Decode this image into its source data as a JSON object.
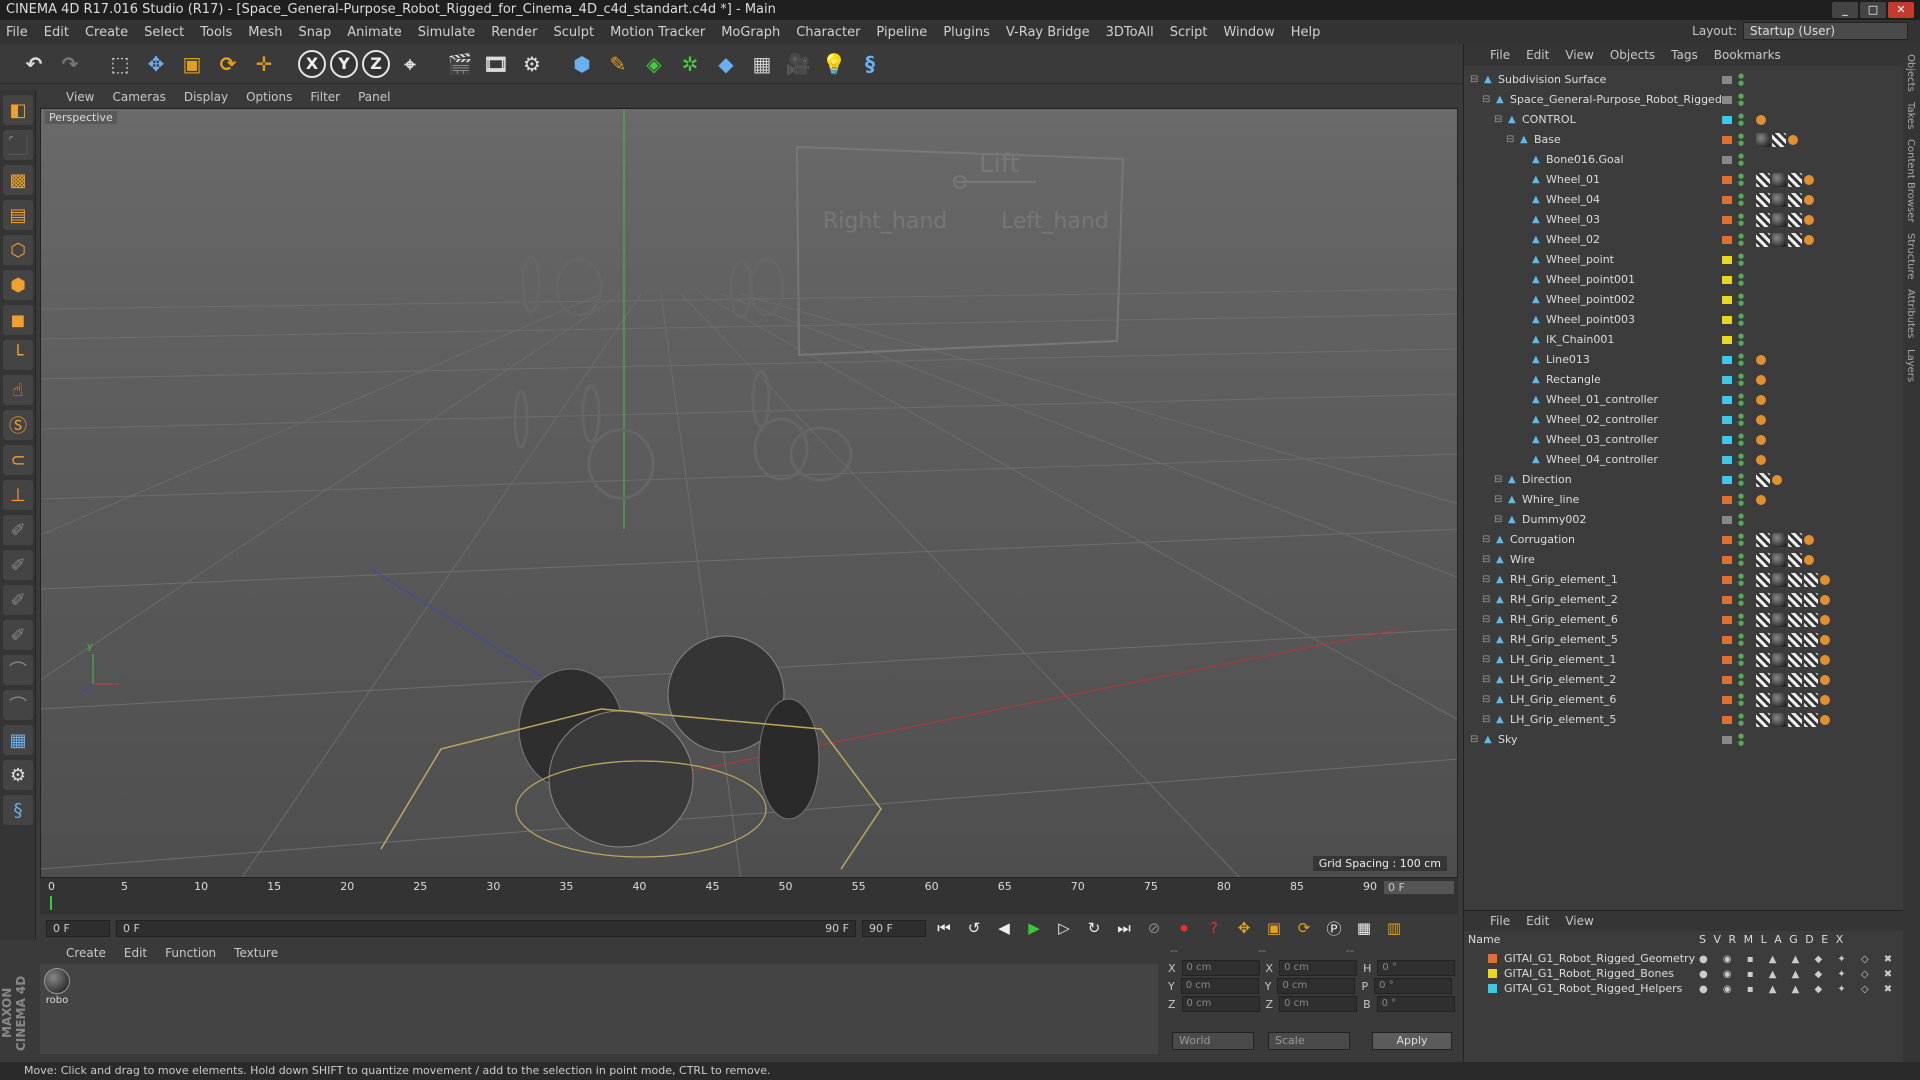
{
  "window": {
    "title": "CINEMA 4D R17.016 Studio (R17) - [Space_General-Purpose_Robot_Rigged_for_Cinema_4D_c4d_standart.c4d *] - Main"
  },
  "menu": [
    "File",
    "Edit",
    "Create",
    "Select",
    "Tools",
    "Mesh",
    "Snap",
    "Animate",
    "Simulate",
    "Render",
    "Sculpt",
    "Motion Tracker",
    "MoGraph",
    "Character",
    "Pipeline",
    "Plugins",
    "V-Ray Bridge",
    "3DToAll",
    "Script",
    "Window",
    "Help"
  ],
  "layout": {
    "label": "Layout:",
    "value": "Startup (User)"
  },
  "toolbar": {
    "axis_x": "X",
    "axis_y": "Y",
    "axis_z": "Z"
  },
  "viewport": {
    "menu": [
      "View",
      "Cameras",
      "Display",
      "Options",
      "Filter",
      "Panel"
    ],
    "label": "Perspective",
    "grid_spacing": "Grid Spacing : 100 cm",
    "board_lift": "Lift",
    "board_right": "Right_hand",
    "board_left": "Left_hand"
  },
  "timeline": {
    "ticks": [
      "0",
      "5",
      "10",
      "15",
      "20",
      "25",
      "30",
      "35",
      "40",
      "45",
      "50",
      "55",
      "60",
      "65",
      "70",
      "75",
      "80",
      "85",
      "90"
    ],
    "current_frame": "0 F"
  },
  "playbar": {
    "start": "0 F",
    "range_start": "0 F",
    "range_end": "90 F",
    "end": "90 F"
  },
  "material": {
    "menu": [
      "Create",
      "Edit",
      "Function",
      "Texture"
    ],
    "name": "robo"
  },
  "coords": {
    "header": [
      "--",
      "--",
      "--"
    ],
    "rows": [
      {
        "a": "X",
        "av": "0 cm",
        "b": "X",
        "bv": "0 cm",
        "c": "H",
        "cv": "0 °"
      },
      {
        "a": "Y",
        "av": "0 cm",
        "b": "Y",
        "bv": "0 cm",
        "c": "P",
        "cv": "0 °"
      },
      {
        "a": "Z",
        "av": "0 cm",
        "b": "Z",
        "bv": "0 cm",
        "c": "B",
        "cv": "0 °"
      }
    ],
    "mode": "World",
    "scale": "Scale",
    "apply": "Apply"
  },
  "brand": "MAXON CINEMA 4D",
  "status": "Move: Click and drag to move elements. Hold down SHIFT to quantize movement / add to the selection in point mode, CTRL to remove.",
  "objects": {
    "menu": [
      "File",
      "Edit",
      "View",
      "Objects",
      "Tags",
      "Bookmarks"
    ],
    "items": [
      {
        "name": "Subdivision Surface",
        "depth": 0,
        "color": "#888888",
        "tags": []
      },
      {
        "name": "Space_General-Purpose_Robot_Rigged",
        "depth": 1,
        "color": "#888888",
        "tags": []
      },
      {
        "name": "CONTROL",
        "depth": 2,
        "color": "#3ec8e8",
        "tags": [
          "o"
        ]
      },
      {
        "name": "Base",
        "depth": 3,
        "color": "#e07030",
        "tags": [
          "k",
          "c",
          "o"
        ]
      },
      {
        "name": "Bone016.Goal",
        "depth": 4,
        "color": "#888888",
        "tags": []
      },
      {
        "name": "Wheel_01",
        "depth": 4,
        "color": "#e07030",
        "tags": [
          "c",
          "k",
          "c",
          "o"
        ]
      },
      {
        "name": "Wheel_04",
        "depth": 4,
        "color": "#e07030",
        "tags": [
          "c",
          "k",
          "c",
          "o"
        ]
      },
      {
        "name": "Wheel_03",
        "depth": 4,
        "color": "#e07030",
        "tags": [
          "c",
          "k",
          "c",
          "o"
        ]
      },
      {
        "name": "Wheel_02",
        "depth": 4,
        "color": "#e07030",
        "tags": [
          "c",
          "k",
          "c",
          "o"
        ]
      },
      {
        "name": "Wheel_point",
        "depth": 4,
        "color": "#e8d820",
        "tags": []
      },
      {
        "name": "Wheel_point001",
        "depth": 4,
        "color": "#e8d820",
        "tags": []
      },
      {
        "name": "Wheel_point002",
        "depth": 4,
        "color": "#e8d820",
        "tags": []
      },
      {
        "name": "Wheel_point003",
        "depth": 4,
        "color": "#e8d820",
        "tags": []
      },
      {
        "name": "IK_Chain001",
        "depth": 4,
        "color": "#e8d820",
        "tags": []
      },
      {
        "name": "Line013",
        "depth": 4,
        "color": "#3ec8e8",
        "tags": [
          "o"
        ]
      },
      {
        "name": "Rectangle",
        "depth": 4,
        "color": "#3ec8e8",
        "tags": [
          "o"
        ]
      },
      {
        "name": "Wheel_01_controller",
        "depth": 4,
        "color": "#3ec8e8",
        "tags": [
          "o"
        ]
      },
      {
        "name": "Wheel_02_controller",
        "depth": 4,
        "color": "#3ec8e8",
        "tags": [
          "o"
        ]
      },
      {
        "name": "Wheel_03_controller",
        "depth": 4,
        "color": "#3ec8e8",
        "tags": [
          "o"
        ]
      },
      {
        "name": "Wheel_04_controller",
        "depth": 4,
        "color": "#3ec8e8",
        "tags": [
          "o"
        ]
      },
      {
        "name": "Direction",
        "depth": 2,
        "color": "#3ec8e8",
        "tags": [
          "c",
          "o"
        ]
      },
      {
        "name": "Whire_line",
        "depth": 2,
        "color": "#e07030",
        "tags": [
          "o"
        ]
      },
      {
        "name": "Dummy002",
        "depth": 2,
        "color": "#888888",
        "tags": []
      },
      {
        "name": "Corrugation",
        "depth": 1,
        "color": "#e07030",
        "tags": [
          "c",
          "k",
          "c",
          "o"
        ]
      },
      {
        "name": "Wire",
        "depth": 1,
        "color": "#e07030",
        "tags": [
          "c",
          "k",
          "c",
          "o"
        ]
      },
      {
        "name": "RH_Grip_element_1",
        "depth": 1,
        "color": "#e07030",
        "tags": [
          "c",
          "k",
          "c",
          "c",
          "o"
        ]
      },
      {
        "name": "RH_Grip_element_2",
        "depth": 1,
        "color": "#e07030",
        "tags": [
          "c",
          "k",
          "c",
          "c",
          "o"
        ]
      },
      {
        "name": "RH_Grip_element_6",
        "depth": 1,
        "color": "#e07030",
        "tags": [
          "c",
          "k",
          "c",
          "c",
          "o"
        ]
      },
      {
        "name": "RH_Grip_element_5",
        "depth": 1,
        "color": "#e07030",
        "tags": [
          "c",
          "k",
          "c",
          "c",
          "o"
        ]
      },
      {
        "name": "LH_Grip_element_1",
        "depth": 1,
        "color": "#e07030",
        "tags": [
          "c",
          "k",
          "c",
          "c",
          "o"
        ]
      },
      {
        "name": "LH_Grip_element_2",
        "depth": 1,
        "color": "#e07030",
        "tags": [
          "c",
          "k",
          "c",
          "c",
          "o"
        ]
      },
      {
        "name": "LH_Grip_element_6",
        "depth": 1,
        "color": "#e07030",
        "tags": [
          "c",
          "k",
          "c",
          "c",
          "o"
        ]
      },
      {
        "name": "LH_Grip_element_5",
        "depth": 1,
        "color": "#e07030",
        "tags": [
          "c",
          "k",
          "c",
          "c",
          "o"
        ]
      },
      {
        "name": "Sky",
        "depth": 0,
        "color": "#888888",
        "tags": []
      }
    ]
  },
  "layers": {
    "menu": [
      "File",
      "Edit",
      "View"
    ],
    "header_name": "Name",
    "header_cols": "S V R M L A G D E X",
    "items": [
      {
        "name": "GITAI_G1_Robot_Rigged_Geometry",
        "color": "#e07030"
      },
      {
        "name": "GITAI_G1_Robot_Rigged_Bones",
        "color": "#e8d820"
      },
      {
        "name": "GITAI_G1_Robot_Rigged_Helpers",
        "color": "#3ec8e8"
      }
    ]
  },
  "side_tabs": [
    "Objects",
    "Takes",
    "Content Browser",
    "Structure",
    "Attributes",
    "Layers"
  ]
}
